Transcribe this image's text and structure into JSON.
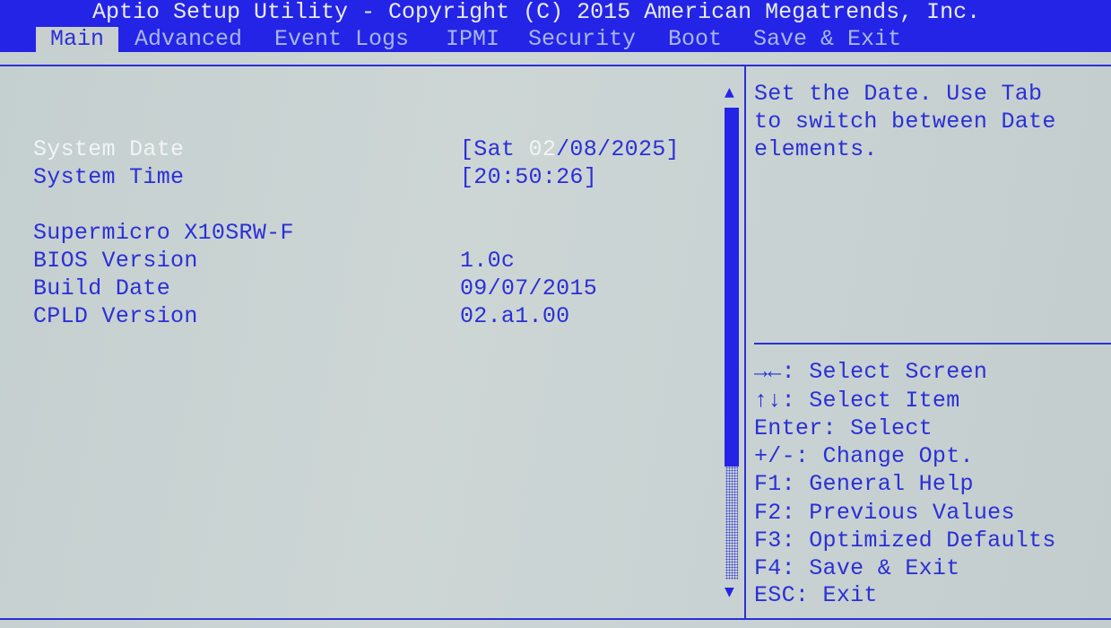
{
  "header": {
    "title": "Aptio Setup Utility - Copyright (C) 2015 American Megatrends, Inc."
  },
  "tabs": [
    {
      "label": "Main",
      "active": true
    },
    {
      "label": "Advanced"
    },
    {
      "label": "Event Logs"
    },
    {
      "label": "IPMI"
    },
    {
      "label": "Security"
    },
    {
      "label": "Boot"
    },
    {
      "label": "Save & Exit"
    }
  ],
  "main": {
    "system_date": {
      "label": "System Date",
      "value_prefix": "[Sat ",
      "value_highlight": "02",
      "value_suffix": "/08/2025]"
    },
    "system_time": {
      "label": "System Time",
      "value": "[20:50:26]"
    },
    "board": "Supermicro X10SRW-F",
    "info": [
      {
        "label": "BIOS Version",
        "value": "1.0c"
      },
      {
        "label": "Build Date",
        "value": "09/07/2015"
      },
      {
        "label": "CPLD Version",
        "value": "02.a1.00"
      }
    ]
  },
  "help": {
    "lines": [
      "Set the Date. Use Tab",
      "to switch between Date",
      "elements."
    ],
    "keys": [
      "→←: Select Screen",
      "↑↓: Select Item",
      "Enter: Select",
      "+/-: Change Opt.",
      "F1: General Help",
      "F2: Previous Values",
      "F3: Optimized Defaults",
      "F4: Save & Exit",
      "ESC: Exit"
    ]
  },
  "colors": {
    "header_bg": "#2424e6",
    "text_blue": "#2b2fd6",
    "selected_text": "#f2f4f4",
    "panel_bg": "#c9d2d2"
  }
}
